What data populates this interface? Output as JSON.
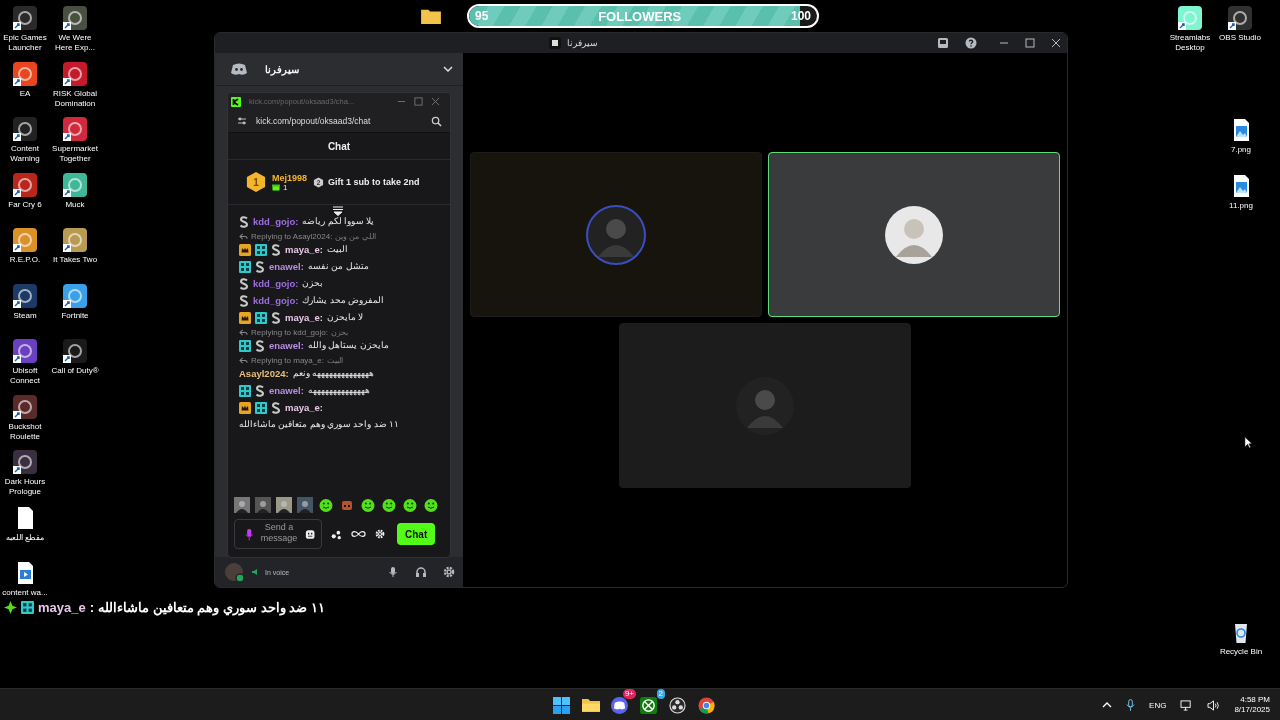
{
  "desktop_left": [
    {
      "label": "Epic Games Launcher",
      "kind": "app",
      "color": "#2a2a2a"
    },
    {
      "label": "EA",
      "kind": "app",
      "color": "#e8461e"
    },
    {
      "label": "Content Warning",
      "kind": "app",
      "color": "#222222"
    },
    {
      "label": "Far Cry 6",
      "kind": "app",
      "color": "#b8261c"
    },
    {
      "label": "R.E.P.O.",
      "kind": "app",
      "color": "#d9912a"
    },
    {
      "label": "Steam",
      "kind": "app",
      "color": "#1b3a66"
    },
    {
      "label": "Ubisoft Connect",
      "kind": "app",
      "color": "#6a3fc0"
    },
    {
      "label": "Buckshot Roulette",
      "kind": "app",
      "color": "#5a2a2a"
    },
    {
      "label": "Dark Hours Prologue",
      "kind": "app",
      "color": "#3a2f40"
    },
    {
      "label": "مقطع اللعبه",
      "kind": "file"
    },
    {
      "label": "content wa...",
      "kind": "video"
    },
    {
      "label": "We Were Here Exp...",
      "kind": "app",
      "color": "#4a5040"
    },
    {
      "label": "RISK Global Domination",
      "kind": "app",
      "color": "#c41a2a"
    },
    {
      "label": "Supermarket Together",
      "kind": "app",
      "color": "#d0283c"
    },
    {
      "label": "Muck",
      "kind": "app",
      "color": "#3fb89a"
    },
    {
      "label": "It Takes Two",
      "kind": "app",
      "color": "#b89a50"
    },
    {
      "label": "Fortnite",
      "kind": "app",
      "color": "#3aa0e8"
    },
    {
      "label": "Call of Duty®",
      "kind": "app",
      "color": "#1a1a1a"
    }
  ],
  "desktop_right": [
    {
      "label": "Streamlabs Desktop",
      "kind": "app",
      "color": "#80f5d2"
    },
    {
      "label": "OBS Studio",
      "kind": "app",
      "color": "#303030"
    },
    {
      "label": "7.png",
      "kind": "image"
    },
    {
      "label": "11.png",
      "kind": "image"
    },
    {
      "label": "Recycle Bin",
      "kind": "recycle"
    }
  ],
  "followers_goal": {
    "current": "95",
    "title": "FOLLOWERS",
    "target": "100",
    "level": 0.95
  },
  "discord": {
    "title": "سيرفرنا",
    "server_name": "سيرفرنا",
    "voice_status": "In voice",
    "tiles": [
      {
        "speaking": false
      },
      {
        "speaking": true
      },
      {
        "speaking": false
      }
    ]
  },
  "kick_popout": {
    "title": "kick.com/popout/oksaad3/cha...",
    "address": "kick.com/popout/oksaad3/chat",
    "header": "Chat",
    "leader": {
      "rank": "1",
      "name": "Mej1998",
      "gifts": "1"
    },
    "next_rank": "2",
    "gift_hint": "Gift 1 sub to take 2nd",
    "messages": [
      {
        "badges": [
          {
            "kind": "sub"
          }
        ],
        "user": "kdd_gojo:",
        "color": "#9d6ee0",
        "text": "يلا سووا لكم رياضه"
      },
      {
        "reply": {
          "label": "Replying to Asayl2024:",
          "quote": "اللي من وين"
        },
        "badges": [
          {
            "kind": "crown"
          },
          {
            "kind": "og"
          },
          {
            "kind": "sub"
          }
        ],
        "user": "maya_e:",
        "color": "#e6c9e6",
        "text": "البيت"
      },
      {
        "badges": [
          {
            "kind": "og"
          },
          {
            "kind": "sub"
          }
        ],
        "user": "enawel:",
        "color": "#b98ce6",
        "text": "متشل من نفسه"
      },
      {
        "badges": [
          {
            "kind": "sub"
          }
        ],
        "user": "kdd_gojo:",
        "color": "#9d6ee0",
        "text": "بحزن"
      },
      {
        "badges": [
          {
            "kind": "sub"
          }
        ],
        "user": "kdd_gojo:",
        "color": "#9d6ee0",
        "text": "المفروض محد يشارك"
      },
      {
        "badges": [
          {
            "kind": "crown"
          },
          {
            "kind": "og"
          },
          {
            "kind": "sub"
          }
        ],
        "user": "maya_e:",
        "color": "#e6c9e6",
        "text": "لا مايحزن"
      },
      {
        "reply": {
          "label": "Replying to kdd_gojo:",
          "quote": "بحزن"
        },
        "badges": [
          {
            "kind": "og"
          },
          {
            "kind": "sub"
          }
        ],
        "user": "enawel:",
        "color": "#b98ce6",
        "text": "مايحزن يستاهل والله"
      },
      {
        "reply": {
          "label": "Replying to maya_e:",
          "quote": "البيت"
        },
        "user": "Asayl2024:",
        "color": "#e8c07a",
        "text": "ههههههههههههههه ونعم"
      },
      {
        "badges": [
          {
            "kind": "og"
          },
          {
            "kind": "sub"
          }
        ],
        "user": "enawel:",
        "color": "#b98ce6",
        "text": "ههههههههههههههه"
      },
      {
        "badges": [
          {
            "kind": "crown"
          },
          {
            "kind": "og"
          },
          {
            "kind": "sub"
          }
        ],
        "user": "maya_e:",
        "color": "#e6c9e6",
        "text": "١١ ضد واحد سوري وهم متعافين ماشاءالله"
      }
    ],
    "input": {
      "placeholder": "Send a message"
    },
    "send_button": "Chat"
  },
  "overlay_message": {
    "user": "maya_e",
    "separator": ":",
    "text": "١١ ضد واحد سوري وهم متعافين ماشاءالله"
  },
  "taskbar": {
    "apps": [
      {
        "kind": "start"
      },
      {
        "kind": "folder"
      },
      {
        "kind": "discord",
        "badge": "9+"
      },
      {
        "kind": "xbox",
        "badge": "2"
      },
      {
        "kind": "obs"
      },
      {
        "kind": "chrome"
      }
    ],
    "language": "ENG",
    "time": "4:58 PM",
    "date": "8/17/2025"
  }
}
